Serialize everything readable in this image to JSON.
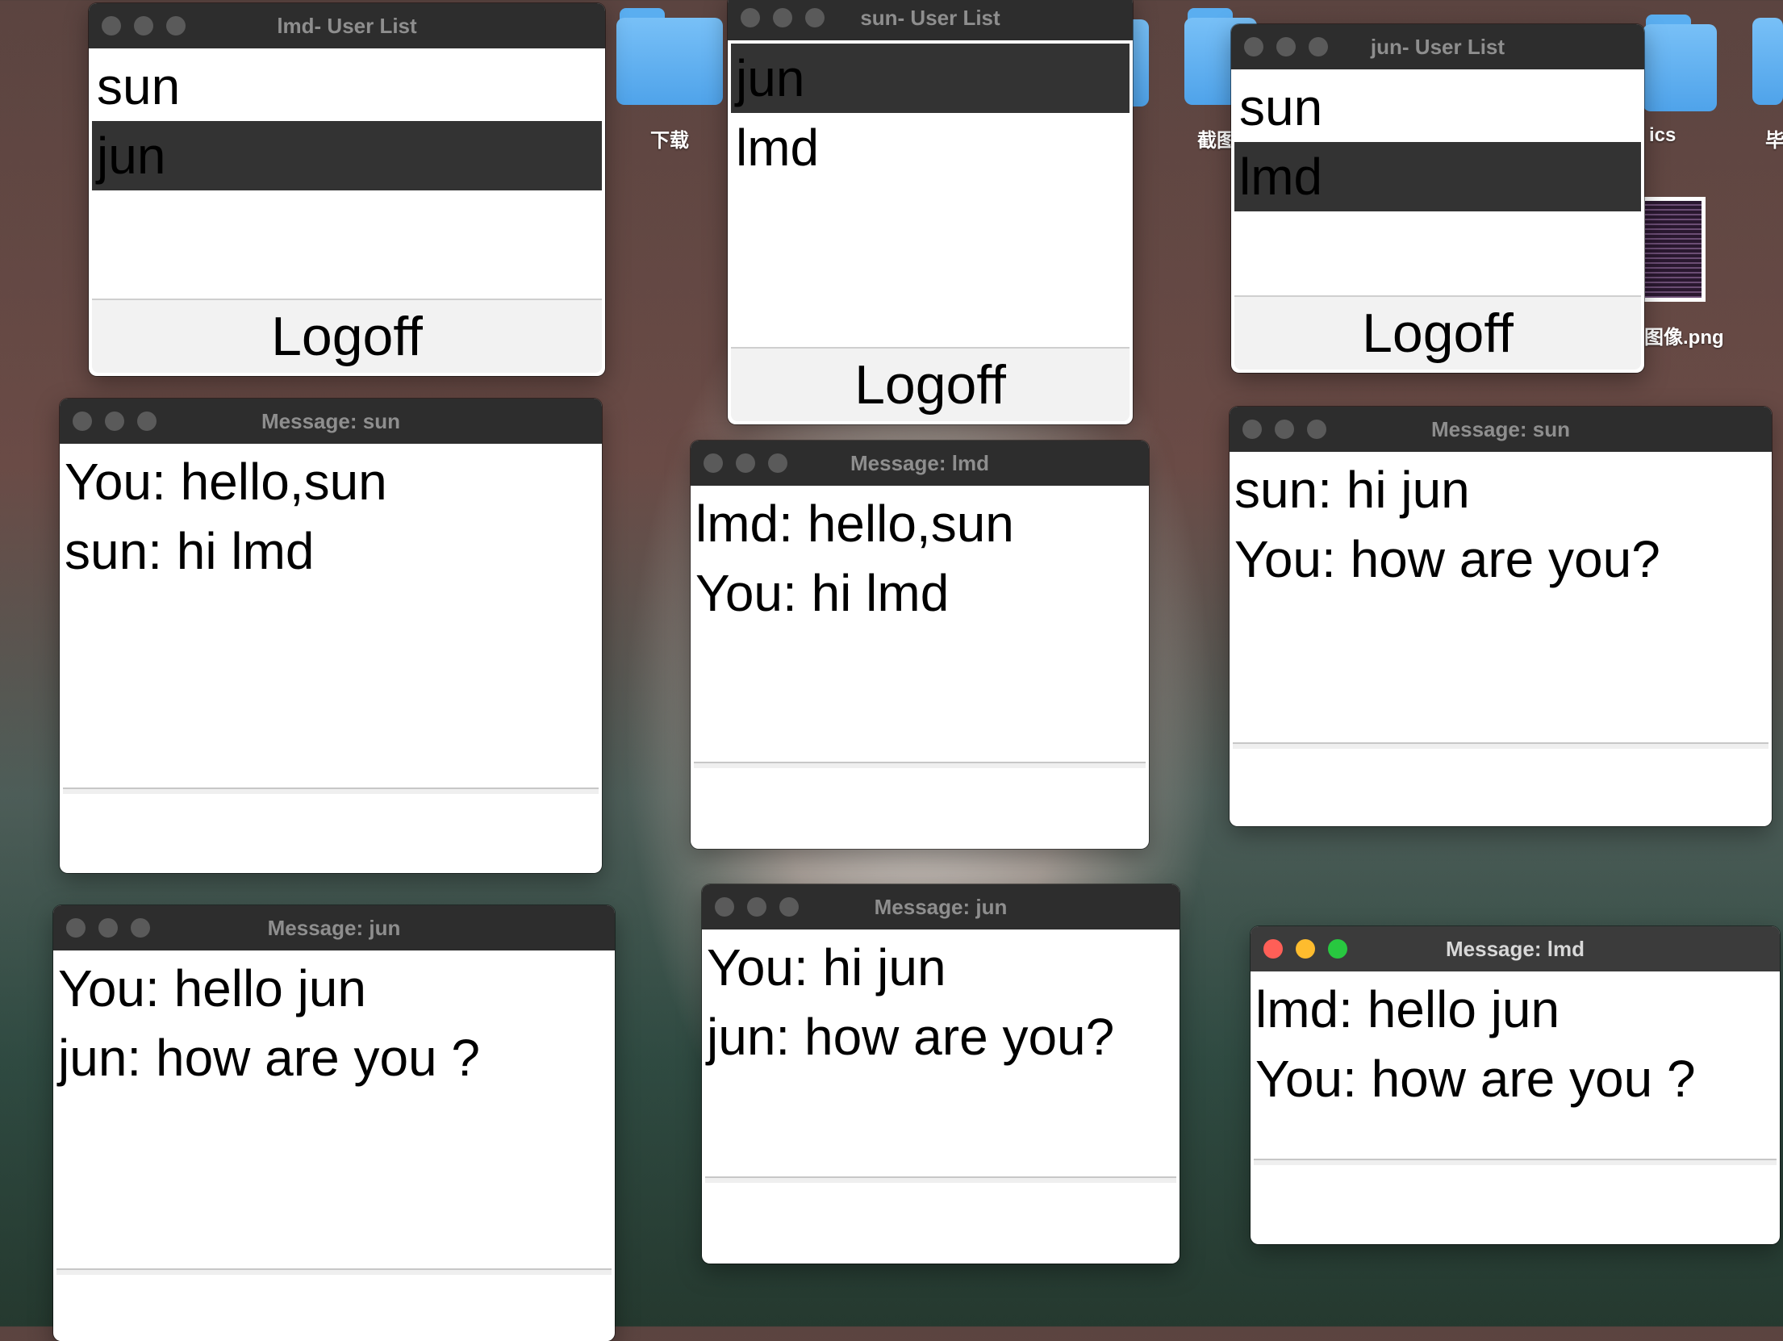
{
  "desktop": {
    "folders": [
      {
        "label": "下载"
      },
      {
        "label": ""
      },
      {
        "label": "截图"
      },
      {
        "label": ""
      },
      {
        "label": ""
      },
      {
        "label": "ics"
      },
      {
        "label": "毕"
      }
    ],
    "image_file": {
      "label": "图像.png"
    }
  },
  "user_lists": [
    {
      "title": "lmd- User List",
      "users": [
        "sun",
        "jun"
      ],
      "selected": "jun",
      "button": "Logoff"
    },
    {
      "title": "sun- User List",
      "users": [
        "jun",
        "lmd"
      ],
      "selected": "jun",
      "button": "Logoff"
    },
    {
      "title": "jun- User List",
      "users": [
        "sun",
        "lmd"
      ],
      "selected": "lmd",
      "button": "Logoff"
    }
  ],
  "message_windows": [
    {
      "title": "Message: sun",
      "lines": [
        "You: hello,sun",
        "sun: hi lmd"
      ],
      "input": ""
    },
    {
      "title": "Message: lmd",
      "lines": [
        "lmd: hello,sun",
        "You: hi lmd"
      ],
      "input": ""
    },
    {
      "title": "Message: sun",
      "lines": [
        "sun: hi jun",
        "You: how are you?"
      ],
      "input": ""
    },
    {
      "title": "Message: jun",
      "lines": [
        "You: hello jun",
        "jun: how are you ?"
      ],
      "input": ""
    },
    {
      "title": "Message: jun",
      "lines": [
        "You: hi jun",
        "jun: how are you?"
      ],
      "input": ""
    },
    {
      "title": "Message: lmd",
      "lines": [
        "lmd: hello jun",
        "You: how are you ?"
      ],
      "input": "",
      "active": true
    }
  ]
}
